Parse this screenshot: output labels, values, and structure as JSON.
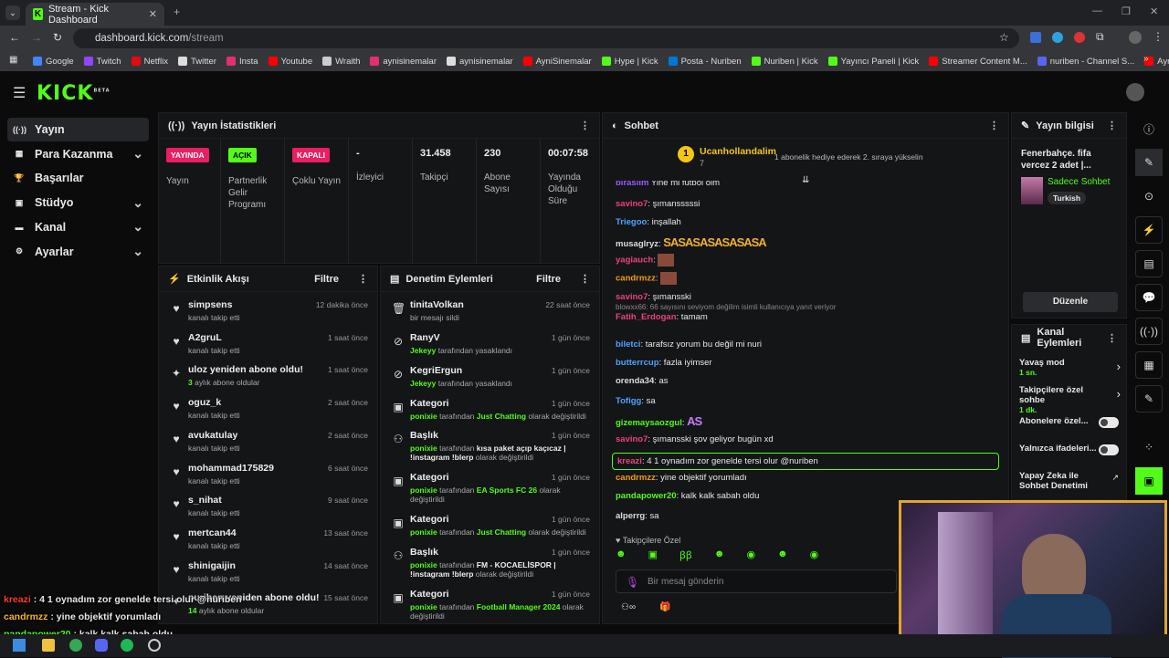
{
  "browser": {
    "tab_title": "Stream - Kick Dashboard",
    "url_domain": "dashboard.kick.com",
    "url_path": "/stream"
  },
  "bookmarks": [
    {
      "label": "Google",
      "color": "#4285f4"
    },
    {
      "label": "Twitch",
      "color": "#9146ff"
    },
    {
      "label": "Netflix",
      "color": "#e50914"
    },
    {
      "label": "Twitter",
      "color": "#dddddd"
    },
    {
      "label": "Insta",
      "color": "#e1306c"
    },
    {
      "label": "Youtube",
      "color": "#ff0000"
    },
    {
      "label": "Wraith",
      "color": "#cccccc"
    },
    {
      "label": "aynisinemalar",
      "color": "#e1306c"
    },
    {
      "label": "aynisinemalar",
      "color": "#dddddd"
    },
    {
      "label": "AyniSinemalar",
      "color": "#ff0000"
    },
    {
      "label": "Hype | Kick",
      "color": "#53fc18"
    },
    {
      "label": "Posta - Nuriben",
      "color": "#0078d4"
    },
    {
      "label": "Nuriben | Kick",
      "color": "#53fc18"
    },
    {
      "label": "Yayıncı Paneli | Kick",
      "color": "#53fc18"
    },
    {
      "label": "Streamer Content M...",
      "color": "#ff0000"
    },
    {
      "label": "nuriben - Channel S...",
      "color": "#5865f2"
    },
    {
      "label": "Aynı Sinemalar - Ça...",
      "color": "#ff0000"
    }
  ],
  "logo": "KICK",
  "logo_sup": "BETA",
  "sidebar": {
    "items": [
      {
        "label": "Yayın",
        "icon": "broadcast-icon",
        "glyph": "((·))",
        "chevron": false
      },
      {
        "label": "Para Kazanma",
        "icon": "money-icon",
        "glyph": "▦",
        "chevron": true
      },
      {
        "label": "Başarılar",
        "icon": "trophy-icon",
        "glyph": "🏆",
        "chevron": false
      },
      {
        "label": "Stüdyo",
        "icon": "studio-icon",
        "glyph": "▣",
        "chevron": true
      },
      {
        "label": "Kanal",
        "icon": "channel-icon",
        "glyph": "▬",
        "chevron": true
      },
      {
        "label": "Ayarlar",
        "icon": "settings-icon",
        "glyph": "⚙",
        "chevron": true
      }
    ]
  },
  "stats": {
    "title": "Yayın İstatistikleri",
    "columns": [
      {
        "badge": "YAYINDA",
        "badge_color": "#e91e63",
        "label": "Yayın"
      },
      {
        "badge": "AÇIK",
        "badge_color": "#53fc18",
        "label": "Partnerlik Gelir Programı"
      },
      {
        "badge": "KAPALI",
        "badge_color": "#e91e63",
        "label": "Çoklu Yayın"
      },
      {
        "value": "-",
        "label": "İzleyici"
      },
      {
        "value": "31.458",
        "label": "Takipçi"
      },
      {
        "value": "230",
        "label": "Abone Sayısı"
      },
      {
        "value": "00:07:58",
        "label": "Yayında Olduğu Süre"
      }
    ]
  },
  "activity": {
    "title": "Etkinlik Akışı",
    "filter": "Filtre",
    "items": [
      {
        "icon": "heart-icon",
        "glyph": "♥",
        "name": "simpsens",
        "sub": "kanalı takip etti",
        "time": "12 dakika önce"
      },
      {
        "icon": "heart-icon",
        "glyph": "♥",
        "name": "A2gruL",
        "sub": "kanalı takip etti",
        "time": "1 saat önce"
      },
      {
        "icon": "sparkle-icon",
        "glyph": "✦",
        "name": "uloz yeniden abone oldu!",
        "subnum": "3",
        "sub": "aylık abone oldular",
        "time": "1 saat önce"
      },
      {
        "icon": "heart-icon",
        "glyph": "♥",
        "name": "oguz_k",
        "sub": "kanalı takip etti",
        "time": "2 saat önce"
      },
      {
        "icon": "heart-icon",
        "glyph": "♥",
        "name": "avukatulay",
        "sub": "kanalı takip etti",
        "time": "2 saat önce"
      },
      {
        "icon": "heart-icon",
        "glyph": "♥",
        "name": "mohammad175829",
        "sub": "kanalı takip etti",
        "time": "6 saat önce"
      },
      {
        "icon": "heart-icon",
        "glyph": "♥",
        "name": "s_nihat",
        "sub": "kanalı takip etti",
        "time": "9 saat önce"
      },
      {
        "icon": "heart-icon",
        "glyph": "♥",
        "name": "mertcan44",
        "sub": "kanalı takip etti",
        "time": "13 saat önce"
      },
      {
        "icon": "heart-icon",
        "glyph": "♥",
        "name": "shinigaijin",
        "sub": "kanalı takip etti",
        "time": "14 saat önce"
      },
      {
        "icon": "sparkle-icon",
        "glyph": "✦",
        "name": "nuriben yeniden abone oldu!",
        "subnum": "14",
        "sub": "aylık abone oldular",
        "time": "15 saat önce"
      }
    ]
  },
  "moderation": {
    "title": "Denetim Eylemleri",
    "filter": "Filtre",
    "items": [
      {
        "icon": "trash-icon",
        "glyph": "🗑",
        "name": "tinitaVolkan",
        "pre": "",
        "by": "",
        "sub": "bir mesajı sildi",
        "time": "22 saat önce"
      },
      {
        "icon": "ban-icon",
        "glyph": "⊘",
        "name": "RanyV",
        "pre": "",
        "by": "Jekeyy",
        "sub": " tarafından yasaklandı",
        "time": "1 gün önce"
      },
      {
        "icon": "ban-icon",
        "glyph": "⊘",
        "name": "KegriErgun",
        "pre": "",
        "by": "Jekeyy",
        "sub": " tarafından yasaklandı",
        "time": "1 gün önce"
      },
      {
        "icon": "category-icon",
        "glyph": "▣",
        "name": "Kategori",
        "pre": "ponixie",
        "by": "Just Chatting",
        "sub": " olarak değiştirildi",
        "time": "1 gün önce",
        "mid": " tarafından "
      },
      {
        "icon": "title-icon",
        "glyph": "⚇",
        "name": "Başlık",
        "pre": "ponixie",
        "by": "kısa paket açıp kaçıcaz | !instagram !blerp",
        "sub": " olarak değiştirildi",
        "time": "1 gün önce",
        "mid": " tarafından "
      },
      {
        "icon": "category-icon",
        "glyph": "▣",
        "name": "Kategori",
        "pre": "ponixie",
        "by": "EA Sports FC 26",
        "sub": " olarak değiştirildi",
        "time": "1 gün önce",
        "mid": " tarafından "
      },
      {
        "icon": "category-icon",
        "glyph": "▣",
        "name": "Kategori",
        "pre": "ponixie",
        "by": "Just Chatting",
        "sub": " olarak değiştirildi",
        "time": "1 gün önce",
        "mid": " tarafından "
      },
      {
        "icon": "title-icon",
        "glyph": "⚇",
        "name": "Başlık",
        "pre": "ponixie",
        "by": "FM - KOCAELİSPOR | !instagram !blerp",
        "sub": " olarak değiştirildi",
        "time": "1 gün önce",
        "mid": " tarafından "
      },
      {
        "icon": "category-icon",
        "glyph": "▣",
        "name": "Kategori",
        "pre": "ponixie",
        "by": "Football Manager 2024",
        "sub": " olarak değiştirildi",
        "time": "1 gün önce",
        "mid": " tarafından "
      }
    ]
  },
  "chat": {
    "title": "Sohbet",
    "pinned_user": "Ucanhollandalim",
    "pinned_count": "7",
    "pinned_msg": "1 abonelik hediye ederek 2. sıraya yükselin",
    "messages": [
      {
        "user": "birasilm",
        "color": "#9b59ff",
        "text": " Yine mi futbol olm"
      },
      {
        "user": "savino7",
        "color": "#e9437b",
        "text": ": şımansssssi"
      },
      {
        "user": "Triegoo",
        "color": "#4fa3ff",
        "text": ": inşallah"
      },
      {
        "user": "musaglryz",
        "color": "#dddddd",
        "text": ": ",
        "emote": "SASASASASASASA"
      },
      {
        "user": "yagiauch",
        "color": "#e9437b",
        "text": ": "
      },
      {
        "user": "candrmzz",
        "color": "#f39c12",
        "text": ": "
      },
      {
        "user": "savino7",
        "color": "#e9437b",
        "text": ": şımansski"
      },
      {
        "reply": "blowxx66: 66 sayısını seviyom değilim isimli kullanıcıya yanıt veriyor",
        "user": "Fatih_Erdogan",
        "color": "#e9437b",
        "text": ": tamam"
      },
      {
        "user": "biletci",
        "color": "#4fa3ff",
        "text": ": tarafsız yorum bu değil mi nuri"
      },
      {
        "user": "butterrcup",
        "color": "#4fa3ff",
        "text": ": fazla iyimser"
      },
      {
        "user": "orenda34",
        "color": "#dddddd",
        "text": ": as"
      },
      {
        "user": "Tofigg",
        "color": "#4fa3ff",
        "text": ": sa"
      },
      {
        "user": "gizemaysaozgul",
        "color": "#53fc18",
        "text": ": ",
        "emote": "AS"
      },
      {
        "user": "savino7",
        "color": "#e9437b",
        "text": ": şımansski şov geliyor bugün xd"
      },
      {
        "user": "kreazi",
        "color": "#e9437b",
        "text": ": 4 1 oynadım zor genelde tersi olur @nuriben"
      },
      {
        "user": "candrmzz",
        "color": "#f39c12",
        "text": ": yine objektif yorumladı"
      },
      {
        "user": "pandapower20",
        "color": "#53fc18",
        "text": ": kalk kalk sabah oldu"
      },
      {
        "user": "alperrg",
        "color": "#dddddd",
        "text": ": sa"
      }
    ],
    "followers_mode": "Takipçilere Özel",
    "input_placeholder": "Bir mesaj gönderin"
  },
  "stream_info": {
    "title": "Yayın bilgisi",
    "stream_title": "Fenerbahçe. fifa vercez 2 adet |...",
    "category": "Sadece Sohbet",
    "language": "Turkish",
    "edit": "Düzenle"
  },
  "channel_actions": {
    "title": "Kanal Eylemleri",
    "items": [
      {
        "label": "Yavaş mod",
        "value": "1 sn.",
        "control": "chevron"
      },
      {
        "label": "Takipçilere özel sohbe",
        "value": "1 dk.",
        "control": "chevron"
      },
      {
        "label": "Abonelere özel...",
        "control": "toggle"
      },
      {
        "label": "Yalnızca ifadeleri...",
        "control": "toggle"
      },
      {
        "label": "Yapay Zeka ile Sohbet Denetimi",
        "control": "link"
      }
    ]
  },
  "overlay_chat": [
    {
      "user": "kreazi",
      "color": "#ff3b30",
      "text": " : 4 1 oynadım zor genelde tersi olur @nuriben"
    },
    {
      "user": "candrmzz",
      "color": "#f3b52b",
      "text": " : yine objektif yorumladı"
    },
    {
      "user": "pandapower20",
      "color": "#53fc18",
      "text": " : kalk kalk sabah oldu"
    },
    {
      "user": "alperrg",
      "color": "#dddddd",
      "text": " : sa"
    }
  ]
}
